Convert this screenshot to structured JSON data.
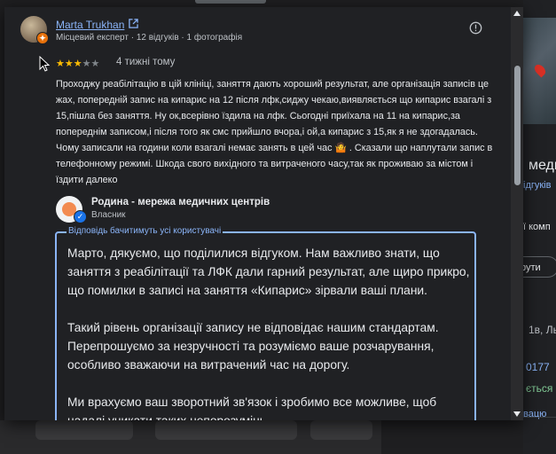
{
  "background": {
    "fragments": {
      "rating_frag": "медичн",
      "reviews_frag": "ідгуків",
      "company_frag": "ї комп",
      "address_frag": "1в, Ль",
      "phone_frag": "0177",
      "status_frag": "ється с",
      "link_frag": "вацю"
    },
    "share_button_label": "рути"
  },
  "review": {
    "reviewer_name": "Marta Trukhan",
    "reviewer_meta": "Місцевий експерт · 12 відгуків · 1 фотографія",
    "rating": 3,
    "max_rating": 5,
    "time_ago": "4 тижні тому",
    "text": "Проходжу реабілітацію в цій клініці, заняття дають хороший результат, але організація записів це жах, попередній запис на кипарис на 12 після лфк,сиджу чекаю,виявляється що кипарис взагалі з 15,пішла без заняття. Ну ок,всерівно їздила на лфк. Сьогодні приїхала на 11 на кипарис,за попереднім записом,і після того як смс прийшло вчора,і ой,а кипарис з 15,як я не здогадалась. Чому записали на години коли взагалі немає занять в цей час 🤷 . Сказали що наплутали запис в телефонному режимі. Шкода свого вихідного та витраченого часу,так як проживаю за містом і їздити далеко"
  },
  "owner": {
    "name": "Родина - мережа медичних центрів",
    "role": "Власник"
  },
  "reply": {
    "legend": "Відповідь бачитимуть усі користувачі",
    "paragraphs": [
      "Марто, дякуємо, що поділилися відгуком. Нам важливо знати, що заняття з реабілітації та ЛФК дали гарний результат, але щиро прикро, що помилки в записі на заняття «Кипарис» зірвали ваші плани.",
      "Такий рівень організації запису не відповідає нашим стандартам. Перепрошуємо за незручності та розуміємо ваше розчарування, особливо зважаючи на витрачений час на дорогу.",
      "Ми врахуємо ваш зворотний зв'язок і зробимо все можливе, щоб надалі уникати таких непорозумінь."
    ]
  },
  "colors": {
    "accent_blue": "#8ab4f8",
    "star_yellow": "#fbbc04",
    "dialog_bg": "#202124"
  },
  "icons": [
    "open-in-new-icon",
    "info-icon",
    "star-icon",
    "verified-check-icon",
    "local-guide-badge-icon",
    "mouse-cursor-icon"
  ]
}
